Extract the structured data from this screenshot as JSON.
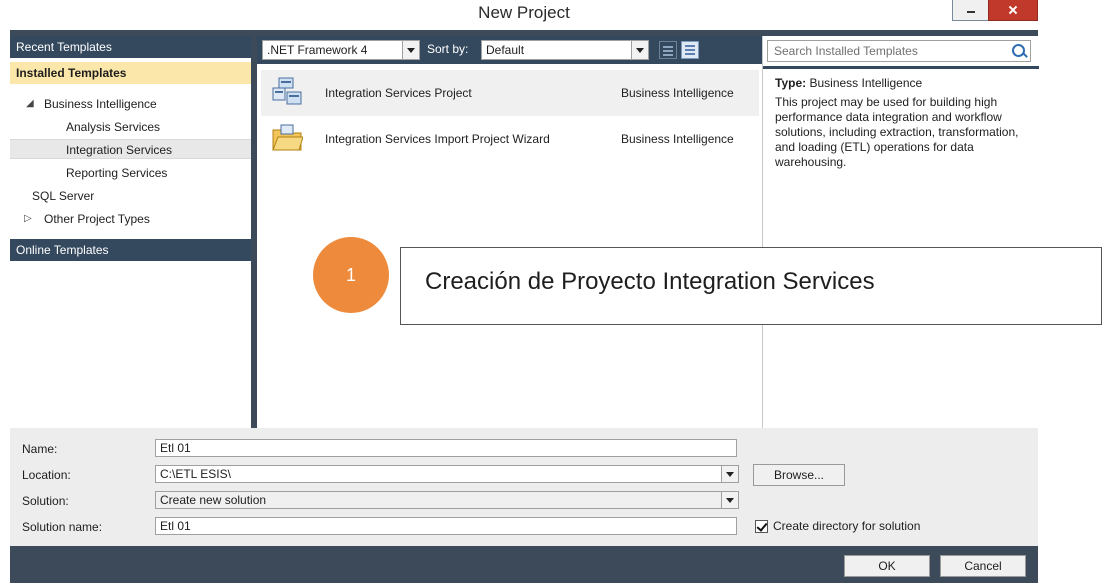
{
  "window": {
    "title": "New Project"
  },
  "left_panel": {
    "recent_label": "Recent Templates",
    "installed_label": "Installed Templates",
    "tree": [
      {
        "label": "Business Intelligence"
      },
      {
        "label": "Analysis Services"
      },
      {
        "label": "Integration Services"
      },
      {
        "label": "Reporting Services"
      },
      {
        "label": "SQL Server"
      },
      {
        "label": "Other Project Types"
      }
    ],
    "online_label": "Online Templates"
  },
  "toolbar": {
    "framework": ".NET Framework 4",
    "sort_label": "Sort by:",
    "sort_value": "Default"
  },
  "templates": [
    {
      "name": "Integration Services Project",
      "category": "Business Intelligence"
    },
    {
      "name": "Integration Services Import Project Wizard",
      "category": "Business Intelligence"
    }
  ],
  "search": {
    "placeholder": "Search Installed Templates"
  },
  "description": {
    "type_label": "Type:",
    "type_value": "Business Intelligence",
    "text": "This project may be used for building high performance data integration and workflow solutions, including extraction, transformation, and loading (ETL) operations for data warehousing."
  },
  "form": {
    "name_label": "Name:",
    "name_value": "Etl 01",
    "location_label": "Location:",
    "location_value": "C:\\ETL ESIS\\",
    "solution_label": "Solution:",
    "solution_value": "Create new solution",
    "solution_name_label": "Solution name:",
    "solution_name_value": "Etl 01",
    "browse_label": "Browse...",
    "create_dir_label": "Create directory for solution",
    "create_dir_checked": true
  },
  "buttons": {
    "ok": "OK",
    "cancel": "Cancel"
  },
  "callout": {
    "number": "1",
    "text": "Creación de Proyecto Integration Services"
  },
  "colors": {
    "dark_bg": "#34495e",
    "highlight": "#fbe7a9",
    "accent_orange": "#ee8a3b",
    "close_red": "#c0392b"
  }
}
